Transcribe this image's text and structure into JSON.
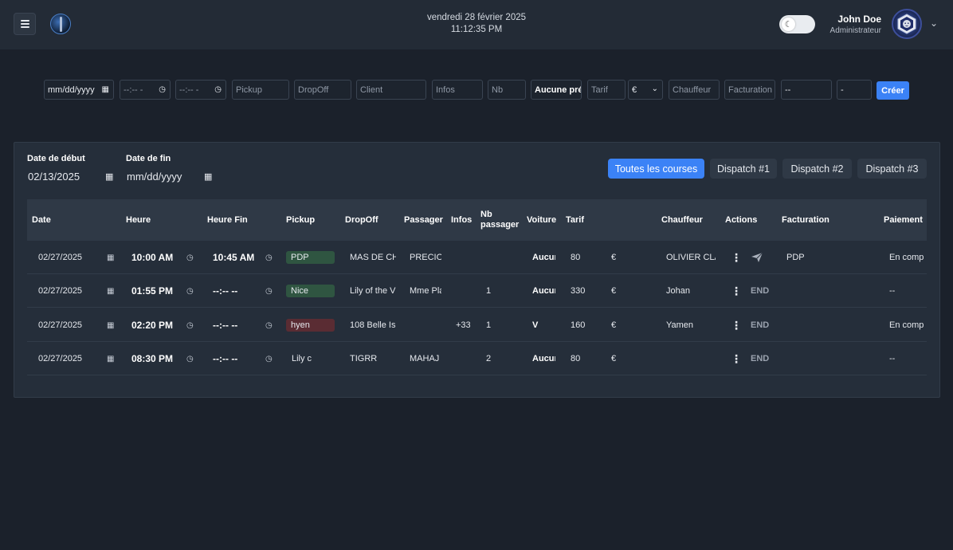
{
  "header": {
    "date": "vendredi 28 février 2025",
    "time": "11:12:35 PM",
    "user_name": "John Doe",
    "user_role": "Administrateur",
    "toggle_icon": "moon-icon"
  },
  "create_form": {
    "date": "mm/dd/yyyy",
    "start_time": "--:-- -",
    "end_time": "--:-- -",
    "pickup_placeholder": "Pickup",
    "dropoff_placeholder": "DropOff",
    "client_placeholder": "Client",
    "infos_placeholder": "Infos",
    "nb_placeholder": "Nb",
    "vehicle": "Aucune pré",
    "tarif_placeholder": "Tarif",
    "currency": "€",
    "chauffeur_placeholder": "Chauffeur",
    "facturation_placeholder": "Facturation",
    "select1": "--",
    "select2": "-",
    "create_label": "Créer"
  },
  "filters": {
    "start_label": "Date de début",
    "start_value": "02/13/2025",
    "end_label": "Date de fin",
    "end_value": "mm/dd/yyyy"
  },
  "tabs": [
    "Toutes les courses",
    "Dispatch #1",
    "Dispatch #2",
    "Dispatch #3"
  ],
  "active_tab": "Toutes les courses",
  "columns": {
    "date": "Date",
    "heure": "Heure",
    "heure_fin": "Heure Fin",
    "pickup": "Pickup",
    "dropoff": "DropOff",
    "passager": "Passager",
    "infos": "Infos",
    "nb_passager_1": "Nb",
    "nb_passager_2": "passager",
    "voiture": "Voiture",
    "tarif": "Tarif",
    "chauffeur": "Chauffeur",
    "actions": "Actions",
    "facturation": "Facturation",
    "paiement": "Paiement"
  },
  "rows": [
    {
      "date": "02/27/2025",
      "heure": "10:00 AM",
      "heure_fin": "10:45 AM",
      "pickup": "PDP",
      "pickup_tone": "green",
      "dropoff": "MAS DE CH",
      "passager": "PRECIO",
      "infos": "",
      "nb": "",
      "voiture": "Aucur",
      "tarif": "80",
      "currency": "€",
      "chauffeur": "OLIVIER CLA",
      "action2": "",
      "facturation": "PDP",
      "paiement": "En comp"
    },
    {
      "date": "02/27/2025",
      "heure": "01:55 PM",
      "heure_fin": "--:-- --",
      "pickup": "Nice",
      "pickup_tone": "green",
      "dropoff": "Lily of the V",
      "passager": "Mme Pla",
      "infos": "",
      "nb": "1",
      "voiture": "Aucur",
      "tarif": "330",
      "currency": "€",
      "chauffeur": "Johan",
      "action2": "END",
      "facturation": "",
      "paiement": "--"
    },
    {
      "date": "02/27/2025",
      "heure": "02:20 PM",
      "heure_fin": "--:-- --",
      "pickup": "hyen",
      "pickup_tone": "red",
      "dropoff": "108 Belle Is",
      "passager": "",
      "infos": "+33",
      "nb": "1",
      "voiture": "V",
      "tarif": "160",
      "currency": "€",
      "chauffeur": "Yamen",
      "action2": "END",
      "facturation": "",
      "paiement": "En comp"
    },
    {
      "date": "02/27/2025",
      "heure": "08:30 PM",
      "heure_fin": "--:-- --",
      "pickup": "Lily c",
      "pickup_tone": "none",
      "dropoff": "TIGRR",
      "passager": "MAHAJ",
      "infos": "",
      "nb": "2",
      "voiture": "Aucur",
      "tarif": "80",
      "currency": "€",
      "chauffeur": "",
      "action2": "END",
      "facturation": "",
      "paiement": "--"
    }
  ],
  "colors": {
    "background": "#1b212b",
    "header": "#232b36",
    "panel": "#252e3a",
    "accent": "#3b82f6",
    "chip_green": "#2f5541",
    "chip_red": "#5a2c33"
  }
}
